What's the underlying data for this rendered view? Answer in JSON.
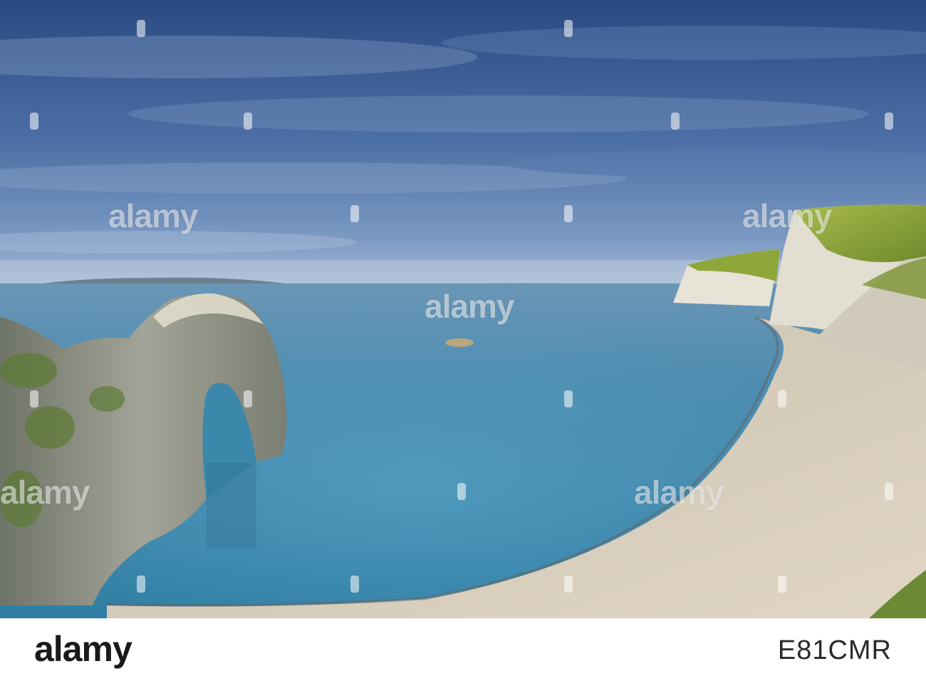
{
  "photo": {
    "subject": "sea-arch-cove-landscape",
    "colors": {
      "sky_top": "#2c4f86",
      "sky_mid": "#4d73a8",
      "sky_horizon": "#9cb3cf",
      "sea_far": "#5d8fb0",
      "sea_near": "#3f86a8",
      "beach": "#d9cfbd",
      "cliff_white": "#e6e2d6",
      "grass": "#8ea63a",
      "rock": "#8d8f84"
    }
  },
  "watermark": {
    "text": "alamy",
    "repeat_count": 9
  },
  "footer": {
    "logo": "alamy",
    "image_id": "E81CMR"
  }
}
